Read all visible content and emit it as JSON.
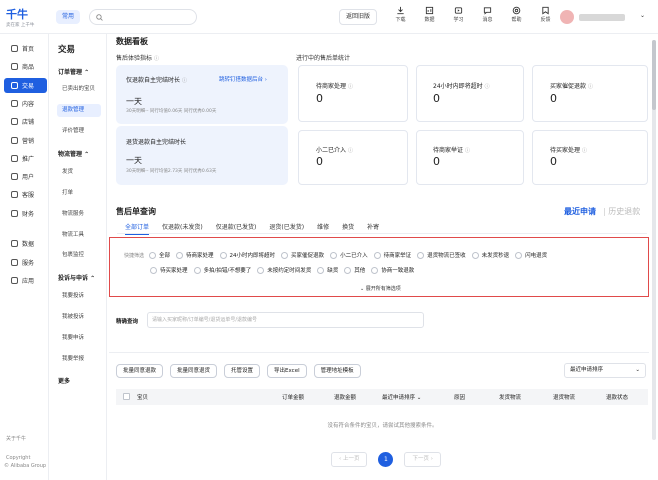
{
  "topbar": {
    "logo_text": "千牛",
    "logo_sub": "卖在家 上千牛",
    "nav_chip": "常用",
    "search_placeholder": "",
    "old_version": "返回旧版",
    "icons": [
      {
        "name": "download-icon",
        "label": "下载"
      },
      {
        "name": "shop-icon",
        "label": "数据"
      },
      {
        "name": "study-icon",
        "label": "学习"
      },
      {
        "name": "message-icon",
        "label": "消息"
      },
      {
        "name": "help-icon",
        "label": "帮助"
      },
      {
        "name": "feedback-icon",
        "label": "反馈"
      }
    ],
    "user_dropdown": "⌄"
  },
  "sidebar": {
    "items": [
      {
        "label": "首页",
        "icon": "home-icon",
        "active": false
      },
      {
        "label": "商品",
        "icon": "goods-icon",
        "active": false
      },
      {
        "label": "交易",
        "icon": "trade-icon",
        "active": true
      },
      {
        "label": "内容",
        "icon": "content-icon",
        "active": false
      },
      {
        "label": "店铺",
        "icon": "store-icon",
        "active": false
      },
      {
        "label": "营销",
        "icon": "marketing-icon",
        "active": false
      },
      {
        "label": "推广",
        "icon": "promotion-icon",
        "active": false
      },
      {
        "label": "用户",
        "icon": "user-icon",
        "active": false
      },
      {
        "label": "客服",
        "icon": "service-icon",
        "active": false
      },
      {
        "label": "财务",
        "icon": "finance-icon",
        "active": false
      },
      {
        "label": "数据",
        "icon": "data-icon",
        "active": false
      },
      {
        "label": "服务",
        "icon": "services-icon",
        "active": false
      },
      {
        "label": "应用",
        "icon": "apps-icon",
        "active": false
      }
    ],
    "about": "关于千牛",
    "copyright": "Copyright",
    "company": "© Alibaba Group"
  },
  "subnav": {
    "title": "交易",
    "group1": "订单管理",
    "group1_items": [
      "已卖出的宝贝",
      "退款管理",
      "评价管理"
    ],
    "group2": "物流管理",
    "group2_items": [
      "发货",
      "打单",
      "物流服务",
      "物流工具",
      "包裹监控"
    ],
    "group3": "投诉与申诉",
    "group3_items": [
      "我要投诉",
      "我被投诉",
      "我要申诉",
      "我要举报"
    ],
    "more": "更多"
  },
  "main": {
    "board_title": "数据看板",
    "after_sale_metric": "售后体验指标",
    "in_progress_stat": "进行中的售后单统计",
    "card1": {
      "label": "仅退款自主完结时长",
      "link": "跳转钉搭数据后台 ›",
      "value": "一天",
      "sub": "30天明细--   同行均值0.06天   同行优秀0.00天"
    },
    "card2": {
      "label": "退货退款自主完结时长",
      "value": "一天",
      "sub": "30天明细--   同行均值2.73天   同行优秀0.63天"
    },
    "stats": [
      {
        "label": "待商家处理",
        "value": "0"
      },
      {
        "label": "24小时内即将超时",
        "value": "0"
      },
      {
        "label": "买家催促退款",
        "value": "0"
      },
      {
        "label": "小二已介入",
        "value": "0"
      },
      {
        "label": "待商家举证",
        "value": "0"
      },
      {
        "label": "待买家处理",
        "value": "0"
      }
    ],
    "query_title": "售后单查询",
    "latest_apply": "最近申请",
    "history": "历史退款",
    "tabs": [
      "全部订单",
      "仅退款(未发货)",
      "仅退款(已发货)",
      "退货(已发货)",
      "维修",
      "换货",
      "补寄"
    ],
    "quick_filter_label": "快捷筛选",
    "filters_row1": [
      "全部",
      "待商家处理",
      "24小时内即将超时",
      "买家催促退款",
      "小二已介入",
      "待商家举证",
      "退货物流已签收",
      "未发货秒退",
      "闪电退货"
    ],
    "filters_row2": [
      "待买家处理",
      "多拍/拍错/不想要了",
      "未按约定时间发货",
      "缺货",
      "其他",
      "协商一致退款"
    ],
    "expand_filters": "⌄ 展开所有筛选项",
    "precise_label": "精确查询",
    "precise_placeholder": "请输入买家昵称/订单编号/退货运单号/退款编号",
    "actions": [
      "批量同意退款",
      "批量同意退货",
      "托管设置",
      "导出Excel",
      "管理地址模板"
    ],
    "sort": "最近申请排序",
    "columns": [
      "宝贝",
      "订单金额",
      "退款金额",
      "最近申请排序 ⌄",
      "原因",
      "发货物流",
      "退货物流",
      "退款状态"
    ],
    "empty_text": "没有符合条件的宝贝，请尝试其他搜索条件。",
    "pager_prev": "‹ 上一页",
    "pager_current": "1",
    "pager_next": "下一页 ›"
  }
}
